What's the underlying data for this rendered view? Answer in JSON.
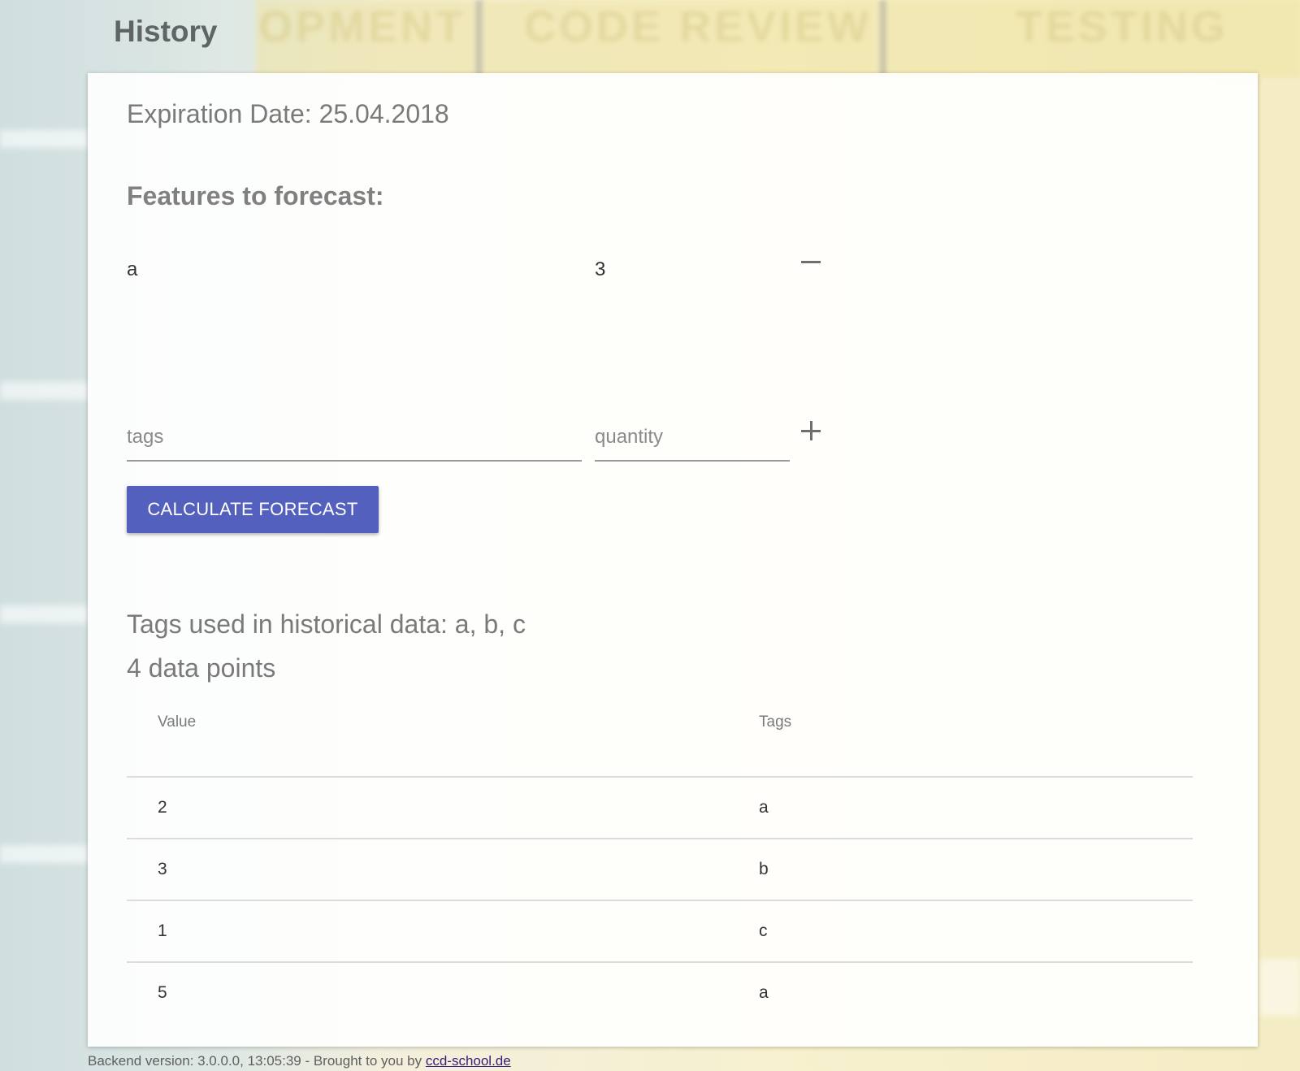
{
  "page": {
    "title": "History"
  },
  "form": {
    "expiration_date": "Expiration Date: 25.04.2018",
    "features_heading": "Features to forecast:",
    "features": [
      {
        "tag": "a",
        "quantity": "3",
        "action_icon": "minus-icon"
      }
    ],
    "tags_placeholder": "tags",
    "quantity_placeholder": "quantity",
    "add_icon": "plus-icon",
    "calculate_label": "CALCULATE FORECAST"
  },
  "history": {
    "tags_summary": "Tags used in historical data: a, b, c",
    "points_summary": "4 data points",
    "columns": [
      "Value",
      "Tags"
    ],
    "rows": [
      {
        "value": "2",
        "tags": "a"
      },
      {
        "value": "3",
        "tags": "b"
      },
      {
        "value": "1",
        "tags": "c"
      },
      {
        "value": "5",
        "tags": "a"
      }
    ]
  },
  "footer": {
    "prefix": "Backend version: 3.0.0.0, 13:05:39 - Brought to you by ",
    "link_text": "ccd-school.de"
  },
  "colors": {
    "accent": "#5360bd",
    "title_text": "#5f6466",
    "muted_text": "#7a7a7a"
  }
}
